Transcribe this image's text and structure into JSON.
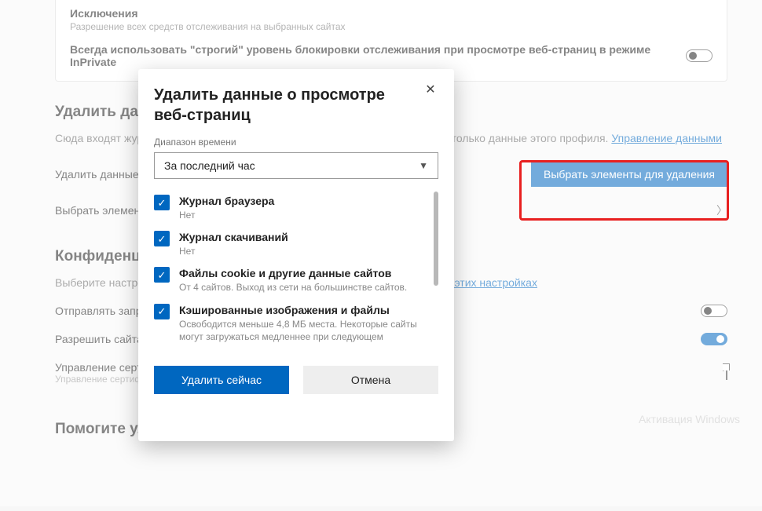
{
  "card": {
    "title": "Исключения",
    "sub": "Разрешение всех средств отслеживания на выбранных сайтах",
    "strict_label": "Всегда использовать \"строгий\" уровень блокировки отслеживания при просмотре веб-страниц в режиме InPrivate"
  },
  "section_delete": {
    "heading": "Удалить данные о просмотре веб-страниц",
    "intro_prefix": "Сюда входят журнал, пароли, файлы cookie и многое другое. Будут удалены только данные этого профиля. ",
    "intro_link": "Управление данными",
    "row_clear_now": "Удалить данные о просмотре веб-страниц",
    "button_choose": "Выбрать элементы для удаления",
    "row_on_close": "Выбрать элементы для удаления при каждом закрытии браузера"
  },
  "section_privacy": {
    "heading": "Конфиденциальность",
    "intro_prefix": "Выберите настройки конфиденциальности для Microsoft Edge. ",
    "intro_link": "Подробнее об этих настройках",
    "row_dnt": "Отправлять запросы \"Не отслеживать\"",
    "row_sites": "Разрешить сайтам проверять наличие сохраненных способов оплаты",
    "row_certs": "Управление сертификатами",
    "row_certs_sub": "Управление сертификатами и параметрами HTTPS/SSL"
  },
  "section_improve": {
    "heading": "Помогите улучшить Microsoft Edge"
  },
  "dialog": {
    "title": "Удалить данные о просмотре веб-страниц",
    "range_label": "Диапазон времени",
    "range_value": "За последний час",
    "items": [
      {
        "title": "Журнал браузера",
        "sub": "Нет"
      },
      {
        "title": "Журнал скачиваний",
        "sub": "Нет"
      },
      {
        "title": "Файлы cookie и другие данные сайтов",
        "sub": "От 4 сайтов. Выход из сети на большинстве сайтов."
      },
      {
        "title": "Кэшированные изображения и файлы",
        "sub": "Освободится меньше 4,8 МБ места. Некоторые сайты могут загружаться медленнее при следующем"
      }
    ],
    "clear_now": "Удалить сейчас",
    "cancel": "Отмена"
  },
  "watermark": "Активация Windows"
}
